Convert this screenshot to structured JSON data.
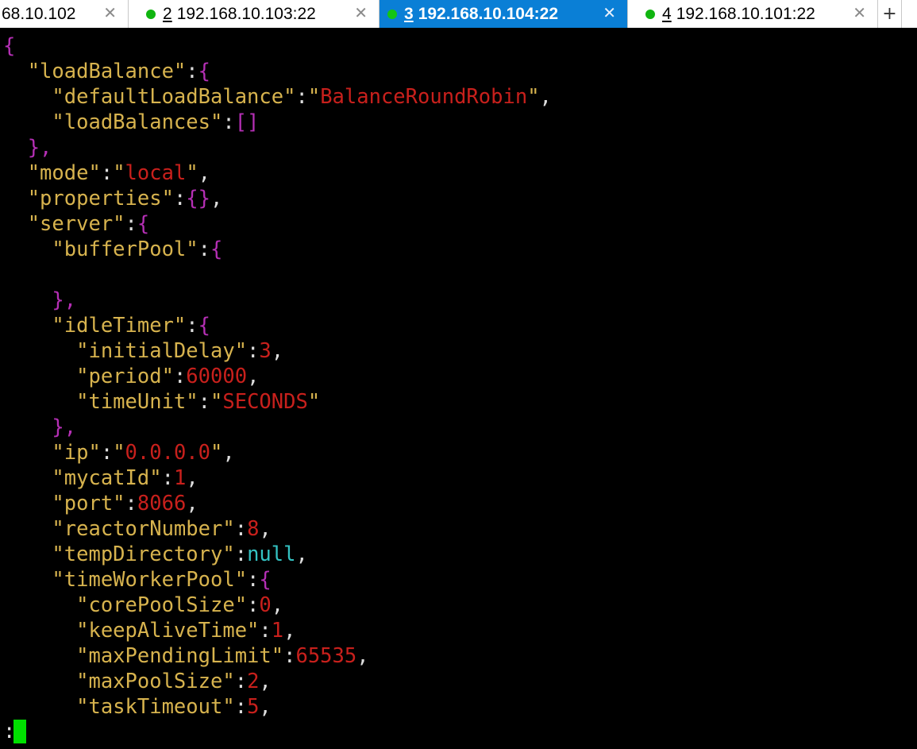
{
  "tabs": [
    {
      "label": "68.10.102",
      "number": "",
      "status": "none"
    },
    {
      "label": "192.168.10.103:22",
      "number": "2",
      "status": "connected"
    },
    {
      "label": "192.168.10.104:22",
      "number": "3",
      "status": "connected",
      "active": true
    },
    {
      "label": "192.168.10.101:22",
      "number": "4",
      "status": "connected"
    }
  ],
  "tab_close_glyph": "✕",
  "new_tab_label": "+",
  "colors": {
    "active_tab": "#0a7fd6",
    "connected_dot": "#10b510",
    "key": "#d7b34e",
    "string": "#c8201c",
    "brace": "#b52fb5",
    "null": "#34c3c3",
    "cursor": "#00e000"
  },
  "terminal_lines": [
    [
      {
        "t": "{",
        "c": "b"
      }
    ],
    [
      {
        "t": "  \"loadBalance\"",
        "c": "k"
      },
      {
        "t": ":",
        "c": "p"
      },
      {
        "t": "{",
        "c": "b"
      }
    ],
    [
      {
        "t": "    \"defaultLoadBalance\"",
        "c": "k"
      },
      {
        "t": ":",
        "c": "p"
      },
      {
        "t": "\"",
        "c": "k"
      },
      {
        "t": "BalanceRoundRobin",
        "c": "s"
      },
      {
        "t": "\"",
        "c": "k"
      },
      {
        "t": ",",
        "c": "p"
      }
    ],
    [
      {
        "t": "    \"loadBalances\"",
        "c": "k"
      },
      {
        "t": ":",
        "c": "p"
      },
      {
        "t": "[]",
        "c": "b"
      }
    ],
    [
      {
        "t": "  },",
        "c": "b"
      }
    ],
    [
      {
        "t": "  \"mode\"",
        "c": "k"
      },
      {
        "t": ":",
        "c": "p"
      },
      {
        "t": "\"",
        "c": "k"
      },
      {
        "t": "local",
        "c": "s"
      },
      {
        "t": "\"",
        "c": "k"
      },
      {
        "t": ",",
        "c": "p"
      }
    ],
    [
      {
        "t": "  \"properties\"",
        "c": "k"
      },
      {
        "t": ":",
        "c": "p"
      },
      {
        "t": "{}",
        "c": "b"
      },
      {
        "t": ",",
        "c": "p"
      }
    ],
    [
      {
        "t": "  \"server\"",
        "c": "k"
      },
      {
        "t": ":",
        "c": "p"
      },
      {
        "t": "{",
        "c": "b"
      }
    ],
    [
      {
        "t": "    \"bufferPool\"",
        "c": "k"
      },
      {
        "t": ":",
        "c": "p"
      },
      {
        "t": "{",
        "c": "b"
      }
    ],
    [
      {
        "t": "",
        "c": "p"
      }
    ],
    [
      {
        "t": "    },",
        "c": "b"
      }
    ],
    [
      {
        "t": "    \"idleTimer\"",
        "c": "k"
      },
      {
        "t": ":",
        "c": "p"
      },
      {
        "t": "{",
        "c": "b"
      }
    ],
    [
      {
        "t": "      \"initialDelay\"",
        "c": "k"
      },
      {
        "t": ":",
        "c": "p"
      },
      {
        "t": "3",
        "c": "n"
      },
      {
        "t": ",",
        "c": "p"
      }
    ],
    [
      {
        "t": "      \"period\"",
        "c": "k"
      },
      {
        "t": ":",
        "c": "p"
      },
      {
        "t": "60000",
        "c": "n"
      },
      {
        "t": ",",
        "c": "p"
      }
    ],
    [
      {
        "t": "      \"timeUnit\"",
        "c": "k"
      },
      {
        "t": ":",
        "c": "p"
      },
      {
        "t": "\"",
        "c": "k"
      },
      {
        "t": "SECONDS",
        "c": "s"
      },
      {
        "t": "\"",
        "c": "k"
      }
    ],
    [
      {
        "t": "    },",
        "c": "b"
      }
    ],
    [
      {
        "t": "    \"ip\"",
        "c": "k"
      },
      {
        "t": ":",
        "c": "p"
      },
      {
        "t": "\"",
        "c": "k"
      },
      {
        "t": "0.0.0.0",
        "c": "s"
      },
      {
        "t": "\"",
        "c": "k"
      },
      {
        "t": ",",
        "c": "p"
      }
    ],
    [
      {
        "t": "    \"mycatId\"",
        "c": "k"
      },
      {
        "t": ":",
        "c": "p"
      },
      {
        "t": "1",
        "c": "n"
      },
      {
        "t": ",",
        "c": "p"
      }
    ],
    [
      {
        "t": "    \"port\"",
        "c": "k"
      },
      {
        "t": ":",
        "c": "p"
      },
      {
        "t": "8066",
        "c": "n"
      },
      {
        "t": ",",
        "c": "p"
      }
    ],
    [
      {
        "t": "    \"reactorNumber\"",
        "c": "k"
      },
      {
        "t": ":",
        "c": "p"
      },
      {
        "t": "8",
        "c": "n"
      },
      {
        "t": ",",
        "c": "p"
      }
    ],
    [
      {
        "t": "    \"tempDirectory\"",
        "c": "k"
      },
      {
        "t": ":",
        "c": "p"
      },
      {
        "t": "null",
        "c": "nl"
      },
      {
        "t": ",",
        "c": "p"
      }
    ],
    [
      {
        "t": "    \"timeWorkerPool\"",
        "c": "k"
      },
      {
        "t": ":",
        "c": "p"
      },
      {
        "t": "{",
        "c": "b"
      }
    ],
    [
      {
        "t": "      \"corePoolSize\"",
        "c": "k"
      },
      {
        "t": ":",
        "c": "p"
      },
      {
        "t": "0",
        "c": "n"
      },
      {
        "t": ",",
        "c": "p"
      }
    ],
    [
      {
        "t": "      \"keepAliveTime\"",
        "c": "k"
      },
      {
        "t": ":",
        "c": "p"
      },
      {
        "t": "1",
        "c": "n"
      },
      {
        "t": ",",
        "c": "p"
      }
    ],
    [
      {
        "t": "      \"maxPendingLimit\"",
        "c": "k"
      },
      {
        "t": ":",
        "c": "p"
      },
      {
        "t": "65535",
        "c": "n"
      },
      {
        "t": ",",
        "c": "p"
      }
    ],
    [
      {
        "t": "      \"maxPoolSize\"",
        "c": "k"
      },
      {
        "t": ":",
        "c": "p"
      },
      {
        "t": "2",
        "c": "n"
      },
      {
        "t": ",",
        "c": "p"
      }
    ],
    [
      {
        "t": "      \"taskTimeout\"",
        "c": "k"
      },
      {
        "t": ":",
        "c": "p"
      },
      {
        "t": "5",
        "c": "n"
      },
      {
        "t": ",",
        "c": "p"
      }
    ]
  ],
  "prompt": ":"
}
